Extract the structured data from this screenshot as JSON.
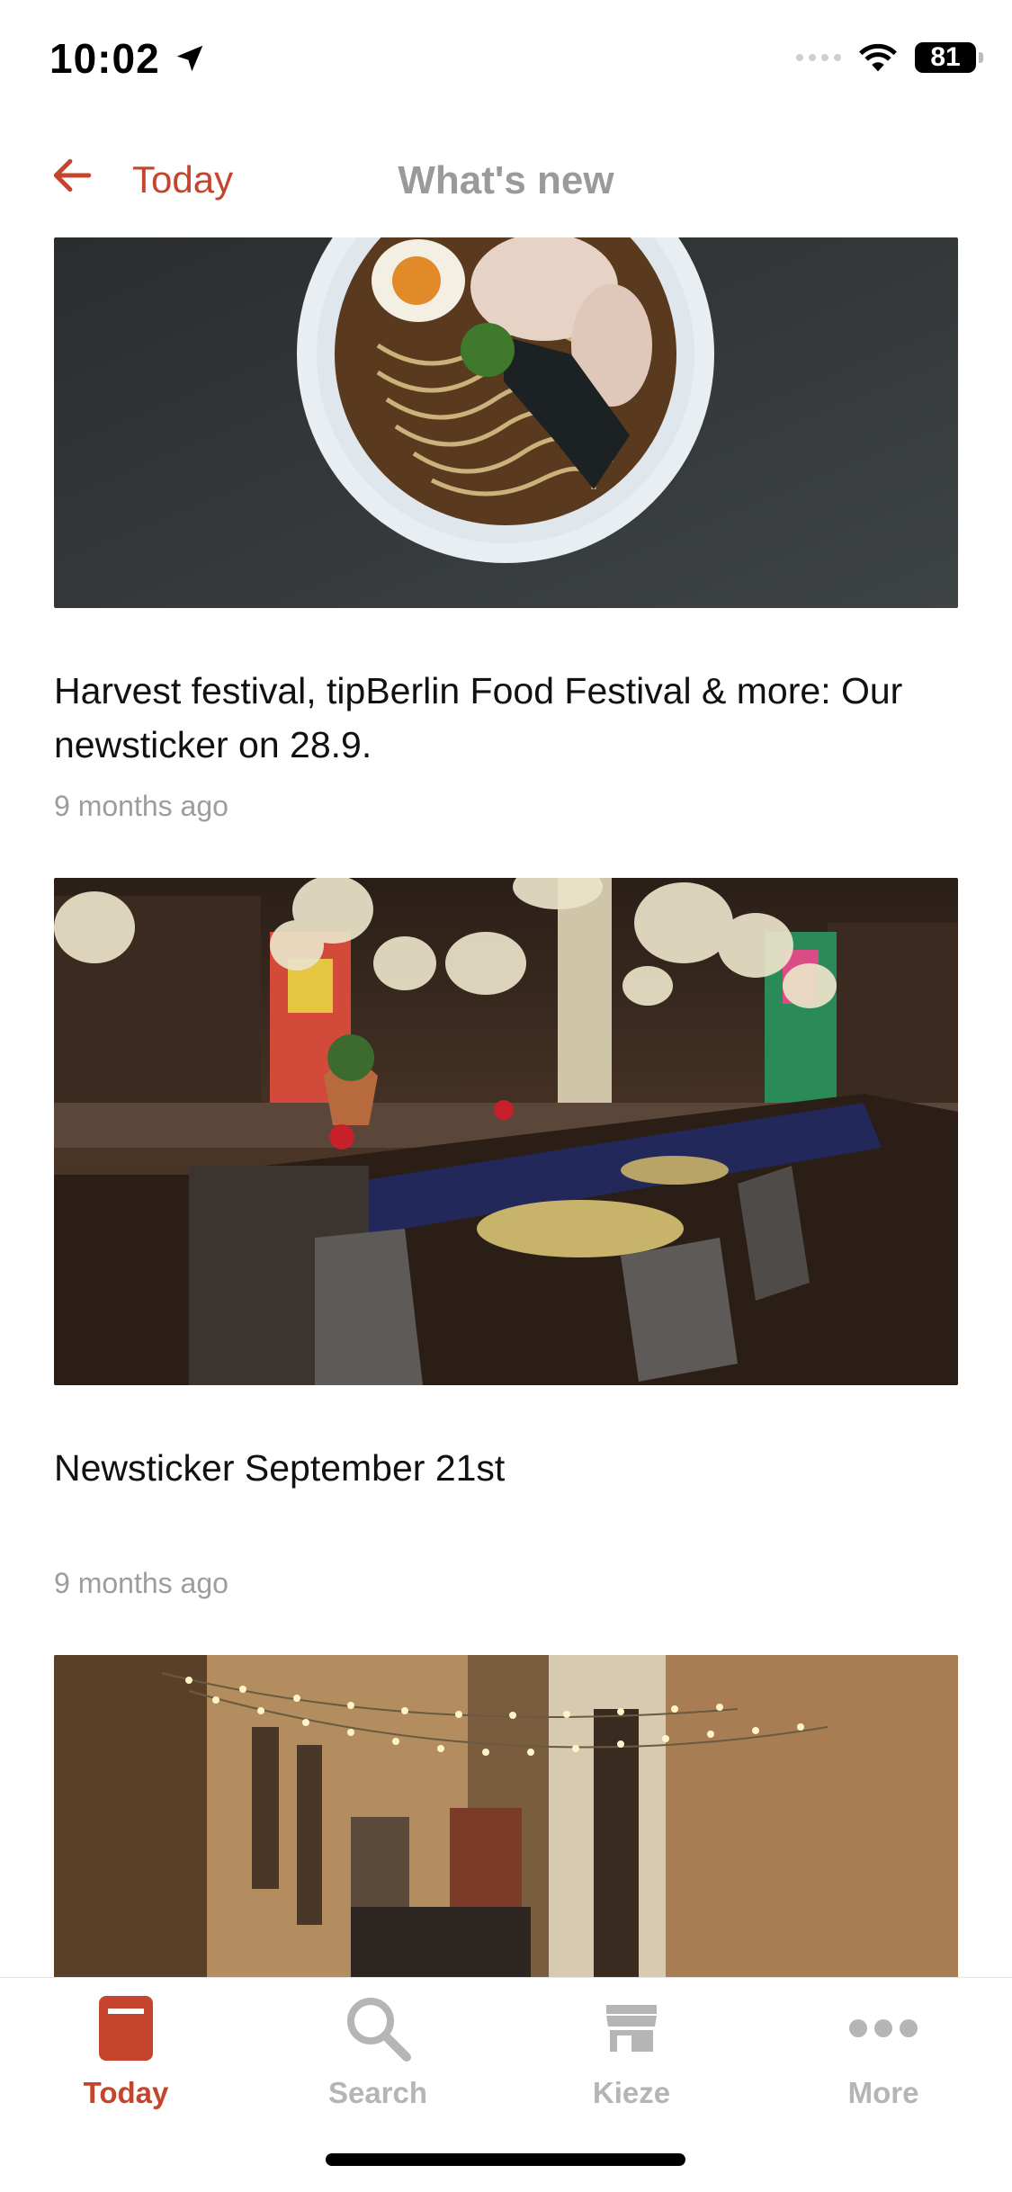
{
  "status_bar": {
    "time": "10:02",
    "battery": "81"
  },
  "header": {
    "back_label": "Today",
    "title": "What's new"
  },
  "articles": [
    {
      "title": "Harvest festival, tipBerlin Food Festival & more: Our newsticker on 28.9.",
      "meta": "9 months ago",
      "image": "ramen-bowl-photo"
    },
    {
      "title": "Newsticker September 21st",
      "meta": "9 months ago",
      "image": "restaurant-interior-photo"
    },
    {
      "image": "courtyard-dining-photo"
    }
  ],
  "tabs": [
    {
      "label": "Today",
      "icon": "today-icon",
      "active": true
    },
    {
      "label": "Search",
      "icon": "search-icon",
      "active": false
    },
    {
      "label": "Kieze",
      "icon": "store-icon",
      "active": false
    },
    {
      "label": "More",
      "icon": "more-dots-icon",
      "active": false
    }
  ],
  "colors": {
    "accent": "#c4442e",
    "inactive": "#b5b5b5",
    "meta": "#9d9d9d"
  }
}
